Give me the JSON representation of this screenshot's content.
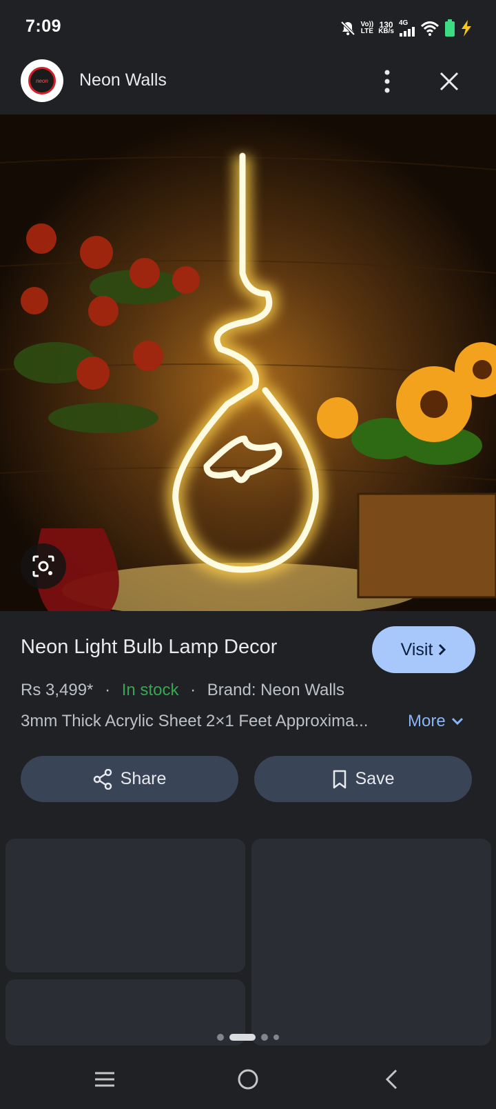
{
  "status_bar": {
    "time": "7:09",
    "volte_top": "Vo))",
    "volte_bottom": "LTE",
    "speed_value": "130",
    "speed_unit": "KB/s",
    "network": "4G"
  },
  "header": {
    "site_name": "Neon Walls",
    "logo_text": "neon"
  },
  "product": {
    "title": "Neon Light Bulb Lamp Decor",
    "visit_label": "Visit",
    "price": "Rs 3,499*",
    "separator": "·",
    "stock": "In stock",
    "brand": "Brand: Neon Walls",
    "description": "3mm Thick Acrylic Sheet 2×1 Feet Approxima...",
    "more_label": "More"
  },
  "actions": {
    "share_label": "Share",
    "save_label": "Save"
  },
  "colors": {
    "background": "#202124",
    "accent_button": "#a8c7fa",
    "in_stock": "#34a853",
    "link": "#8ab4f8",
    "action_button": "#394457"
  }
}
